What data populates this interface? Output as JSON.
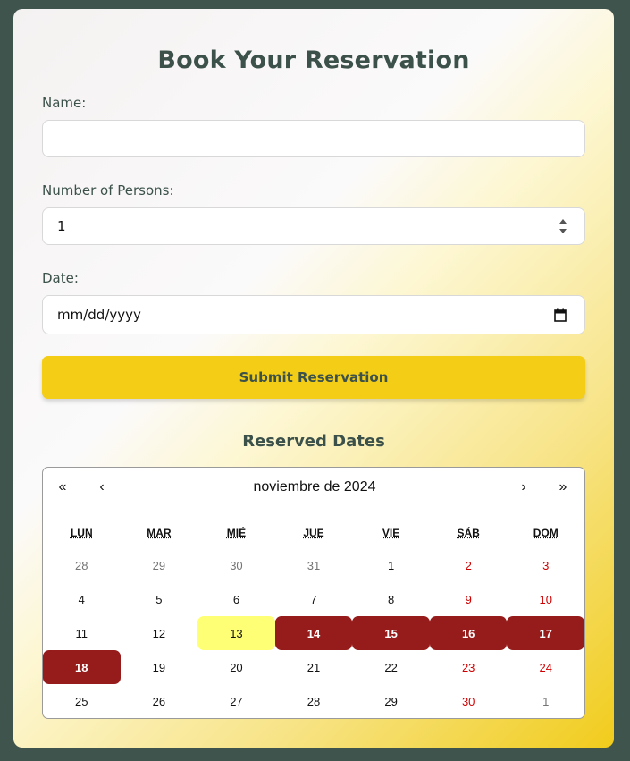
{
  "form": {
    "title": "Book Your Reservation",
    "name_label": "Name:",
    "name_value": "",
    "persons_label": "Number of Persons:",
    "persons_value": "1",
    "date_label": "Date:",
    "date_placeholder": "mm/dd/yyyy",
    "submit_label": "Submit Reservation"
  },
  "reserved": {
    "title": "Reserved Dates",
    "calendar": {
      "nav": {
        "prev_year": "«",
        "prev_month": "‹",
        "next_month": "›",
        "next_year": "»"
      },
      "month_label": "noviembre de 2024",
      "weekdays": [
        "LUN",
        "MAR",
        "MIÉ",
        "JUE",
        "VIE",
        "SÁB",
        "DOM"
      ],
      "weeks": [
        [
          {
            "d": "28",
            "s": "other"
          },
          {
            "d": "29",
            "s": "other"
          },
          {
            "d": "30",
            "s": "other"
          },
          {
            "d": "31",
            "s": "other"
          },
          {
            "d": "1",
            "s": ""
          },
          {
            "d": "2",
            "s": "weekend"
          },
          {
            "d": "3",
            "s": "weekend"
          }
        ],
        [
          {
            "d": "4",
            "s": ""
          },
          {
            "d": "5",
            "s": ""
          },
          {
            "d": "6",
            "s": ""
          },
          {
            "d": "7",
            "s": ""
          },
          {
            "d": "8",
            "s": ""
          },
          {
            "d": "9",
            "s": "weekend"
          },
          {
            "d": "10",
            "s": "weekend"
          }
        ],
        [
          {
            "d": "11",
            "s": ""
          },
          {
            "d": "12",
            "s": ""
          },
          {
            "d": "13",
            "s": "today"
          },
          {
            "d": "14",
            "s": "reserved"
          },
          {
            "d": "15",
            "s": "reserved"
          },
          {
            "d": "16",
            "s": "reserved"
          },
          {
            "d": "17",
            "s": "reserved"
          }
        ],
        [
          {
            "d": "18",
            "s": "reserved"
          },
          {
            "d": "19",
            "s": ""
          },
          {
            "d": "20",
            "s": ""
          },
          {
            "d": "21",
            "s": ""
          },
          {
            "d": "22",
            "s": ""
          },
          {
            "d": "23",
            "s": "weekend"
          },
          {
            "d": "24",
            "s": "weekend"
          }
        ],
        [
          {
            "d": "25",
            "s": ""
          },
          {
            "d": "26",
            "s": ""
          },
          {
            "d": "27",
            "s": ""
          },
          {
            "d": "28",
            "s": ""
          },
          {
            "d": "29",
            "s": ""
          },
          {
            "d": "30",
            "s": "weekend"
          },
          {
            "d": "1",
            "s": "other"
          }
        ]
      ]
    }
  },
  "colors": {
    "background": "#3f544d",
    "text": "#3b514a",
    "accent": "#f4cd17",
    "reserved": "#961b1b",
    "today": "#ffff76",
    "weekend": "#d10000"
  }
}
